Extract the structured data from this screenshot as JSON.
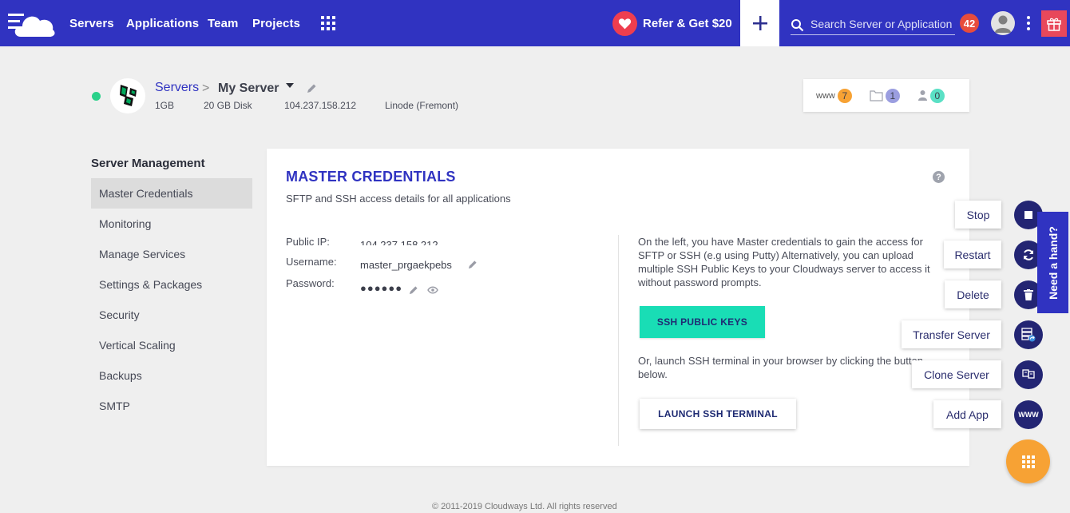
{
  "nav": {
    "links": [
      "Servers",
      "Applications",
      "Team",
      "Projects"
    ],
    "refer_label": "Refer & Get $20",
    "search_placeholder": "Search Server or Application",
    "notifications_count": "42",
    "icons": [
      "cloudways-logo-icon",
      "apps-grid-icon",
      "heart-icon",
      "plus-icon",
      "search-icon",
      "user-avatar-icon",
      "more-vert-icon",
      "gift-icon"
    ]
  },
  "server": {
    "breadcrumb_root": "Servers",
    "breadcrumb_separator": ">",
    "name": "My Server",
    "ram": "1GB",
    "disk": "20 GB Disk",
    "ip": "104.237.158.212",
    "provider": "Linode (Fremont)",
    "status_color": "#2ad18a",
    "stats": {
      "www_label": "www",
      "apps_count": "7",
      "files_count": "1",
      "users_count": "0",
      "colors": {
        "apps": "#f7a234",
        "files": "#9b9ee0",
        "users": "#5be0c5"
      }
    }
  },
  "sidebar": {
    "title": "Server Management",
    "items": [
      {
        "label": "Master Credentials",
        "active": true
      },
      {
        "label": "Monitoring"
      },
      {
        "label": "Manage Services"
      },
      {
        "label": "Settings & Packages"
      },
      {
        "label": "Security"
      },
      {
        "label": "Vertical Scaling"
      },
      {
        "label": "Backups"
      },
      {
        "label": "SMTP"
      }
    ]
  },
  "credentials": {
    "title": "MASTER CREDENTIALS",
    "subtitle": "SFTP and SSH access details for all applications",
    "help": "?",
    "public_ip_label": "Public IP:",
    "public_ip_value": "104.237.158.212",
    "username_label": "Username:",
    "username_value": "master_prgaekpebs",
    "password_label": "Password:",
    "password_value": "●●●●●●",
    "description": "On the left, you have Master credentials to gain the access for SFTP or SSH (e.g using Putty) Alternatively, you can upload multiple SSH Public Keys to your Cloudways server to access it without password prompts.",
    "ssh_keys_button": "SSH PUBLIC KEYS",
    "terminal_text": "Or, launch SSH terminal in your browser by clicking the button below.",
    "terminal_button": "LAUNCH SSH TERMINAL"
  },
  "actions": [
    {
      "label": "Stop",
      "icon": "stop-icon"
    },
    {
      "label": "Restart",
      "icon": "restart-icon"
    },
    {
      "label": "Delete",
      "icon": "trash-icon"
    },
    {
      "label": "Transfer Server",
      "icon": "transfer-icon"
    },
    {
      "label": "Clone Server",
      "icon": "clone-icon"
    },
    {
      "label": "Add App",
      "icon": "www-icon"
    }
  ],
  "fab_www_label": "WWW",
  "help_tab": "Need a hand?",
  "footer": "© 2011-2019 Cloudways Ltd. All rights reserved",
  "colors": {
    "primary": "#3033c1",
    "accent_teal": "#19ddb5",
    "fab_orange": "#f7a234",
    "fab_navy": "#232573"
  }
}
